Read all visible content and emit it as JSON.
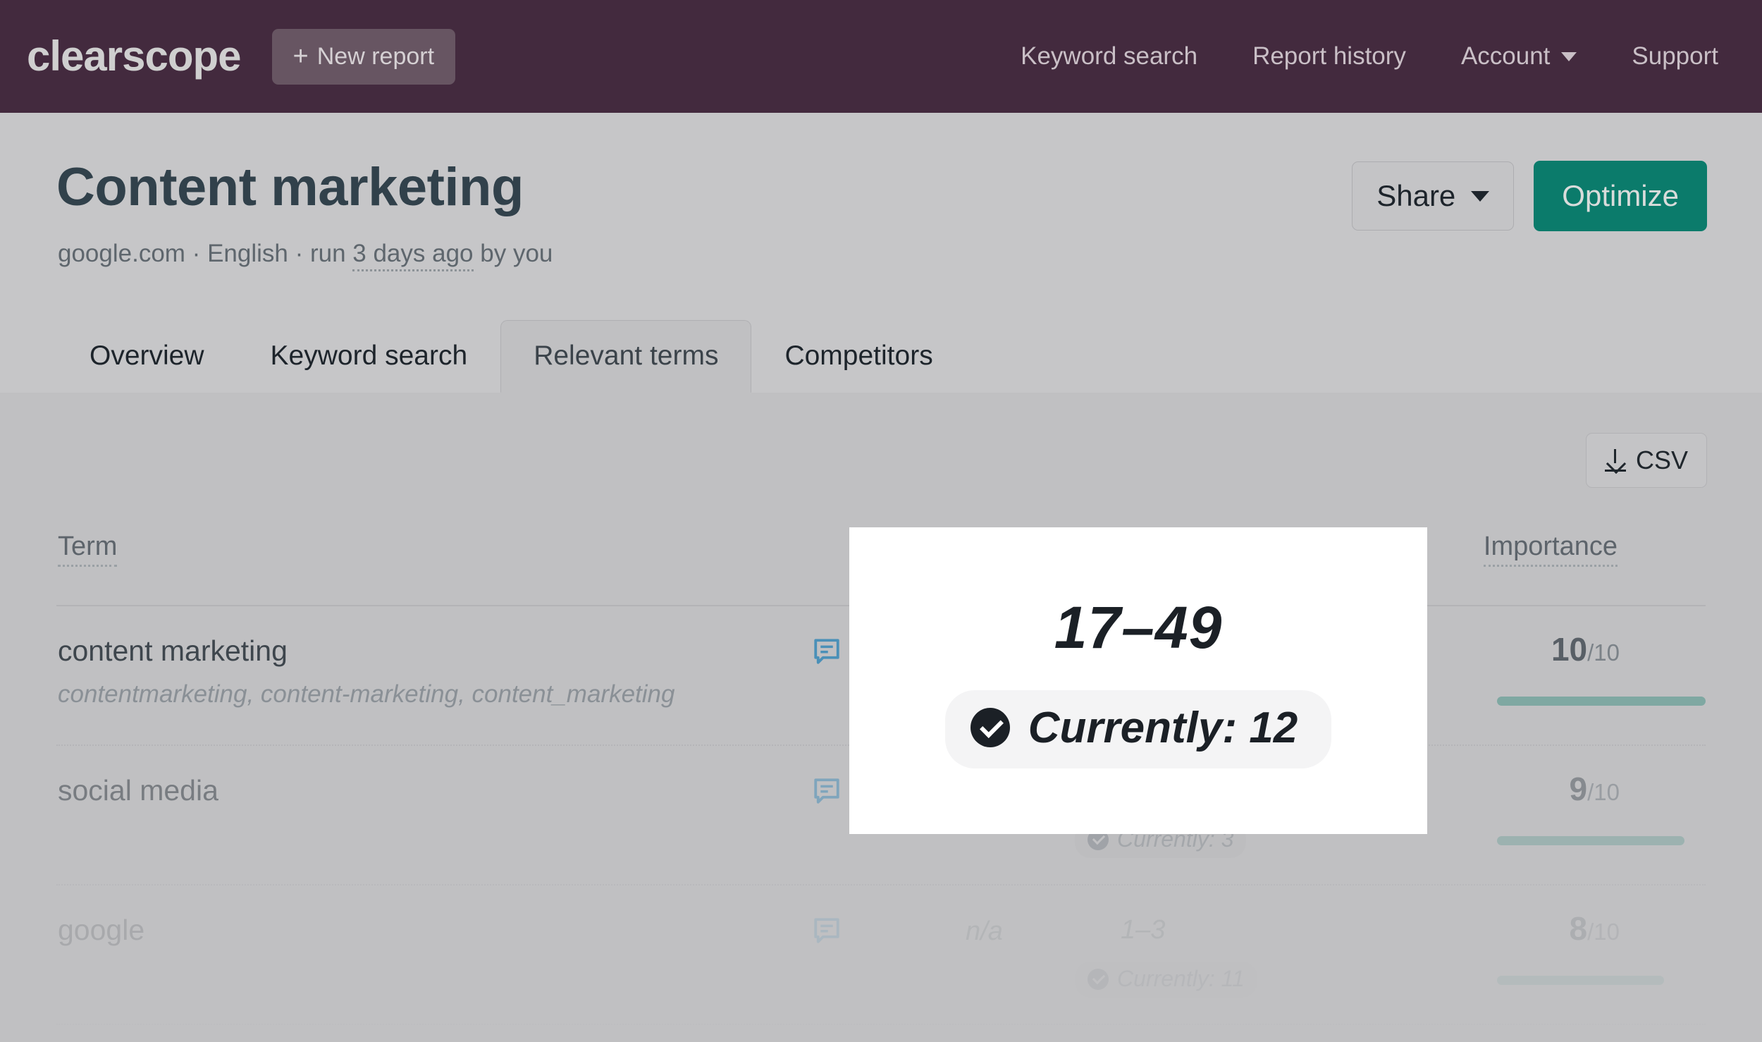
{
  "topnav": {
    "brand": "clearscope",
    "new_report_label": "New report",
    "new_report_plus": "+",
    "links": [
      {
        "label": "Keyword search",
        "has_caret": false
      },
      {
        "label": "Report history",
        "has_caret": false
      },
      {
        "label": "Account",
        "has_caret": true
      },
      {
        "label": "Support",
        "has_caret": false
      }
    ]
  },
  "header": {
    "title": "Content marketing",
    "meta_domain": "google.com",
    "meta_sep1": " · ",
    "meta_language": "English",
    "meta_sep2": " · run ",
    "meta_age": "3 days ago",
    "meta_by": " by you",
    "share_label": "Share",
    "optimize_label": "Optimize"
  },
  "tabs": [
    {
      "label": "Overview",
      "active": false
    },
    {
      "label": "Keyword search",
      "active": false
    },
    {
      "label": "Relevant terms",
      "active": true
    },
    {
      "label": "Competitors",
      "active": false
    }
  ],
  "toolbar": {
    "csv_label": "CSV",
    "csv_icon": "download-icon"
  },
  "table": {
    "columns": [
      "Term",
      "Importance"
    ],
    "rows": [
      {
        "term": "content marketing",
        "variants": "contentmarketing, content-marketing, content_marketing",
        "comment_icon": "comment-icon",
        "volume": "",
        "range": "",
        "currently": "",
        "score": "10",
        "score_denominator": "/10",
        "bar_percent": 100
      },
      {
        "term": "social media",
        "variants": "",
        "comment_icon": "comment-icon",
        "volume": "",
        "range": "",
        "currently": "Currently: 3",
        "score": "9",
        "score_denominator": "/10",
        "bar_percent": 90
      },
      {
        "term": "google",
        "variants": "",
        "comment_icon": "comment-icon",
        "volume": "n/a",
        "range": "1–3",
        "currently": "Currently: 11",
        "score": "8",
        "score_denominator": "/10",
        "bar_percent": 80
      }
    ]
  },
  "zoom_card": {
    "range": "17–49",
    "currently_label": "Currently: 12",
    "check_icon": "check-circle-icon"
  },
  "colors": {
    "nav_background": "#432a3e",
    "optimize_green": "#0b7b6b",
    "bar_teal": "#7fa8a2",
    "comment_blue": "#4a90b8"
  }
}
